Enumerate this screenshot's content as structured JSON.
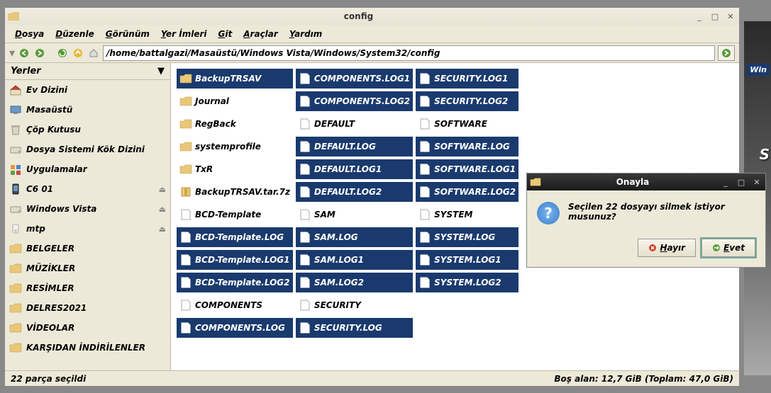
{
  "window": {
    "title": "config",
    "path": "/home/battalgazi/Masaüstü/Windows Vista/Windows/System32/config"
  },
  "menu": {
    "file": "Dosya",
    "edit": "Düzenle",
    "view": "Görünüm",
    "bookmarks": "Yer İmleri",
    "go": "Git",
    "tools": "Araçlar",
    "help": "Yardım"
  },
  "sidebar": {
    "header": "Yerler",
    "items": [
      {
        "name": "home",
        "label": "Ev Dizini",
        "icon": "house"
      },
      {
        "name": "desktop",
        "label": "Masaüstü",
        "icon": "desktop"
      },
      {
        "name": "trash",
        "label": "Çöp Kutusu",
        "icon": "trash"
      },
      {
        "name": "fsroot",
        "label": "Dosya Sistemi Kök Dizini",
        "icon": "drive"
      },
      {
        "name": "apps",
        "label": "Uygulamalar",
        "icon": "apps"
      },
      {
        "name": "c601",
        "label": "C6 01",
        "icon": "phone",
        "eject": true
      },
      {
        "name": "vista",
        "label": "Windows Vista",
        "icon": "drive",
        "eject": true
      },
      {
        "name": "mtp",
        "label": "mtp",
        "icon": "mtp",
        "eject": true
      },
      {
        "name": "docs",
        "label": "BELGELER",
        "icon": "folder"
      },
      {
        "name": "music",
        "label": "MÜZİKLER",
        "icon": "folder"
      },
      {
        "name": "pics",
        "label": "RESİMLER",
        "icon": "folder"
      },
      {
        "name": "delres",
        "label": "DELRES2021",
        "icon": "folder"
      },
      {
        "name": "videos",
        "label": "VİDEOLAR",
        "icon": "folder"
      },
      {
        "name": "downloads",
        "label": "KARŞIDAN İNDİRİLENLER",
        "icon": "folder"
      }
    ]
  },
  "columns": [
    [
      {
        "label": "BackupTRSAV",
        "icon": "folder",
        "sel": true
      },
      {
        "label": "Journal",
        "icon": "folder",
        "sel": false
      },
      {
        "label": "RegBack",
        "icon": "folder",
        "sel": false
      },
      {
        "label": "systemprofile",
        "icon": "folder",
        "sel": false
      },
      {
        "label": "TxR",
        "icon": "folder",
        "sel": false
      },
      {
        "label": "BackupTRSAV.tar.7z",
        "icon": "archive",
        "sel": false
      },
      {
        "label": "BCD-Template",
        "icon": "page",
        "sel": false
      },
      {
        "label": "BCD-Template.LOG",
        "icon": "page",
        "sel": true
      },
      {
        "label": "BCD-Template.LOG1",
        "icon": "page",
        "sel": true
      },
      {
        "label": "BCD-Template.LOG2",
        "icon": "page",
        "sel": true
      },
      {
        "label": "COMPONENTS",
        "icon": "page",
        "sel": false
      },
      {
        "label": "COMPONENTS.LOG",
        "icon": "page",
        "sel": true
      }
    ],
    [
      {
        "label": "COMPONENTS.LOG1",
        "icon": "page",
        "sel": true
      },
      {
        "label": "COMPONENTS.LOG2",
        "icon": "page",
        "sel": true
      },
      {
        "label": "DEFAULT",
        "icon": "page",
        "sel": false
      },
      {
        "label": "DEFAULT.LOG",
        "icon": "page",
        "sel": true
      },
      {
        "label": "DEFAULT.LOG1",
        "icon": "page",
        "sel": true
      },
      {
        "label": "DEFAULT.LOG2",
        "icon": "page",
        "sel": true
      },
      {
        "label": "SAM",
        "icon": "page",
        "sel": false
      },
      {
        "label": "SAM.LOG",
        "icon": "page",
        "sel": true
      },
      {
        "label": "SAM.LOG1",
        "icon": "page",
        "sel": true
      },
      {
        "label": "SAM.LOG2",
        "icon": "page",
        "sel": true
      },
      {
        "label": "SECURITY",
        "icon": "page",
        "sel": false
      },
      {
        "label": "SECURITY.LOG",
        "icon": "page",
        "sel": true
      }
    ],
    [
      {
        "label": "SECURITY.LOG1",
        "icon": "page",
        "sel": true
      },
      {
        "label": "SECURITY.LOG2",
        "icon": "page",
        "sel": true
      },
      {
        "label": "SOFTWARE",
        "icon": "page",
        "sel": false
      },
      {
        "label": "SOFTWARE.LOG",
        "icon": "page",
        "sel": true
      },
      {
        "label": "SOFTWARE.LOG1",
        "icon": "page",
        "sel": true
      },
      {
        "label": "SOFTWARE.LOG2",
        "icon": "page",
        "sel": true
      },
      {
        "label": "SYSTEM",
        "icon": "page",
        "sel": false
      },
      {
        "label": "SYSTEM.LOG",
        "icon": "page",
        "sel": true
      },
      {
        "label": "SYSTEM.LOG1",
        "icon": "page",
        "sel": true
      },
      {
        "label": "SYSTEM.LOG2",
        "icon": "page",
        "sel": true
      }
    ]
  ],
  "status": {
    "left": "22 parça seçildi",
    "right": "Boş alan: 12,7 GiB (Toplam: 47,0 GiB)"
  },
  "dialog": {
    "title": "Onayla",
    "message": "Seçilen 22 dosyayı silmek istiyor musunuz?",
    "no": "Hayır",
    "yes": "Evet"
  },
  "bg": {
    "partial1": "Win",
    "partial2": "S"
  }
}
